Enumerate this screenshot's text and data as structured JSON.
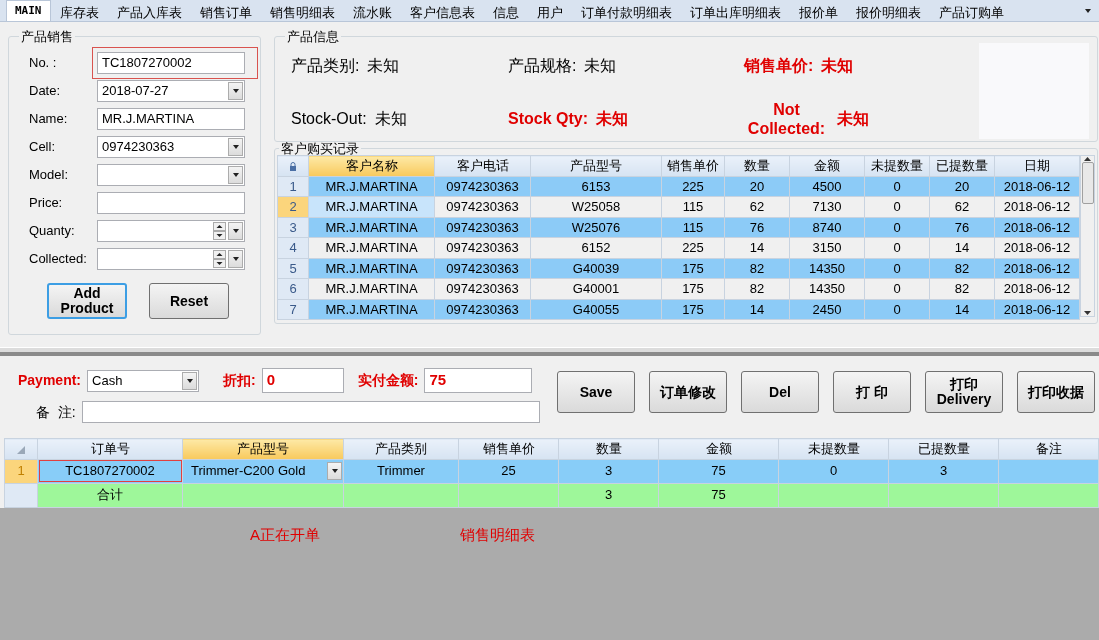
{
  "tabs": [
    {
      "label": "MAIN",
      "selected": true
    },
    {
      "label": "库存表",
      "selected": false
    },
    {
      "label": "产品入库表",
      "selected": false
    },
    {
      "label": "销售订单",
      "selected": false
    },
    {
      "label": "销售明细表",
      "selected": false
    },
    {
      "label": "流水账",
      "selected": false
    },
    {
      "label": "客户信息表",
      "selected": false
    },
    {
      "label": "信息",
      "selected": false
    },
    {
      "label": "用户",
      "selected": false
    },
    {
      "label": "订单付款明细表",
      "selected": false
    },
    {
      "label": "订单出库明细表",
      "selected": false
    },
    {
      "label": "报价单",
      "selected": false
    },
    {
      "label": "报价明细表",
      "selected": false
    },
    {
      "label": "产品订购单",
      "selected": false
    }
  ],
  "sales_form": {
    "title": "产品销售",
    "fields": [
      {
        "label": "No. :",
        "kind": "text",
        "value": "TC1807270002",
        "highlighted": true
      },
      {
        "label": "Date:",
        "kind": "combo",
        "value": "2018-07-27",
        "highlighted": false
      },
      {
        "label": "Name:",
        "kind": "text",
        "value": "MR.J.MARTINA",
        "highlighted": false
      },
      {
        "label": "Cell:",
        "kind": "combo",
        "value": "0974230363",
        "highlighted": false
      },
      {
        "label": "Model:",
        "kind": "combo",
        "highlighted": false
      },
      {
        "label": "Price:",
        "kind": "text",
        "highlighted": false
      },
      {
        "label": "Quanty:",
        "kind": "spin",
        "highlighted": false
      },
      {
        "label": "Collected:",
        "kind": "spin",
        "highlighted": false
      }
    ],
    "buttons": [
      {
        "label": "Add Product",
        "focused": true
      },
      {
        "label": "Reset",
        "focused": false
      }
    ]
  },
  "product_info": {
    "title": "产品信息",
    "items": [
      {
        "label": "产品类别:",
        "value": "未知",
        "emphasis": false
      },
      {
        "label": "产品规格:",
        "value": "未知",
        "emphasis": false
      },
      {
        "label": "销售单价:",
        "value": "未知",
        "emphasis": true
      },
      {
        "label": "Stock-Out:",
        "value": "未知",
        "emphasis": false
      },
      {
        "label": "Stock Qty:",
        "value": "未知",
        "emphasis": true
      },
      {
        "label": "Not Collected:",
        "value": "未知",
        "emphasis": true
      }
    ]
  },
  "purchase_history": {
    "title": "客户购买记录",
    "columns": [
      {
        "label": "客户名称",
        "selected": true
      },
      {
        "label": "客户电话",
        "selected": false
      },
      {
        "label": "产品型号",
        "selected": false
      },
      {
        "label": "销售单价",
        "selected": false
      },
      {
        "label": "数量",
        "selected": false
      },
      {
        "label": "金额",
        "selected": false
      },
      {
        "label": "未提数量",
        "selected": false
      },
      {
        "label": "已提数量",
        "selected": false
      },
      {
        "label": "日期",
        "selected": false
      }
    ],
    "rows": [
      {
        "number": "1",
        "current": false,
        "cells": [
          "MR.J.MARTINA",
          "0974230363",
          "6153",
          "225",
          "20",
          "4500",
          "0",
          "20",
          "2018-06-12"
        ]
      },
      {
        "number": "2",
        "current": true,
        "cells": [
          "MR.J.MARTINA",
          "0974230363",
          "W25058",
          "115",
          "62",
          "7130",
          "0",
          "62",
          "2018-06-12"
        ]
      },
      {
        "number": "3",
        "current": false,
        "cells": [
          "MR.J.MARTINA",
          "0974230363",
          "W25076",
          "115",
          "76",
          "8740",
          "0",
          "76",
          "2018-06-12"
        ]
      },
      {
        "number": "4",
        "current": false,
        "cells": [
          "MR.J.MARTINA",
          "0974230363",
          "6152",
          "225",
          "14",
          "3150",
          "0",
          "14",
          "2018-06-12"
        ]
      },
      {
        "number": "5",
        "current": false,
        "cells": [
          "MR.J.MARTINA",
          "0974230363",
          "G40039",
          "175",
          "82",
          "14350",
          "0",
          "82",
          "2018-06-12"
        ]
      },
      {
        "number": "6",
        "current": false,
        "cells": [
          "MR.J.MARTINA",
          "0974230363",
          "G40001",
          "175",
          "82",
          "14350",
          "0",
          "82",
          "2018-06-12"
        ]
      },
      {
        "number": "7",
        "current": false,
        "cells": [
          "MR.J.MARTINA",
          "0974230363",
          "G40055",
          "175",
          "14",
          "2450",
          "0",
          "14",
          "2018-06-12"
        ]
      }
    ]
  },
  "order": {
    "payment": {
      "label": "Payment:",
      "value": "Cash"
    },
    "discount": {
      "label": "折扣:",
      "value": "0"
    },
    "paid": {
      "label": "实付金额:",
      "value": "75"
    },
    "remark": {
      "label": "备  注:"
    },
    "buttons": [
      {
        "label": "Save"
      },
      {
        "label": "订单修改"
      },
      {
        "label": "Del"
      },
      {
        "label": "打 印"
      },
      {
        "label": "打印 Delivery"
      },
      {
        "label": "打印收据"
      }
    ]
  },
  "order_grid": {
    "columns": [
      {
        "label": "订单号",
        "selected": false
      },
      {
        "label": "产品型号",
        "selected": true
      },
      {
        "label": "产品类别",
        "selected": false
      },
      {
        "label": "销售单价",
        "selected": false
      },
      {
        "label": "数量",
        "selected": false
      },
      {
        "label": "金额",
        "selected": false
      },
      {
        "label": "未提数量",
        "selected": false
      },
      {
        "label": "已提数量",
        "selected": false
      },
      {
        "label": "备注",
        "selected": false
      }
    ],
    "rows": [
      {
        "number": "1",
        "cells": [
          {
            "text": "TC1807270002",
            "kind": "text",
            "highlighted": true
          },
          {
            "text": "Trimmer-C200 Gold",
            "kind": "dropdown",
            "highlighted": false
          },
          {
            "text": "Trimmer",
            "kind": "text",
            "highlighted": false
          },
          {
            "text": "25",
            "kind": "text",
            "highlighted": false
          },
          {
            "text": "3",
            "kind": "text",
            "highlighted": false
          },
          {
            "text": "75",
            "kind": "text",
            "highlighted": false
          },
          {
            "text": "0",
            "kind": "text",
            "highlighted": false
          },
          {
            "text": "3",
            "kind": "text",
            "highlighted": false
          },
          {
            "kind": "text",
            "highlighted": false
          }
        ]
      }
    ],
    "total": {
      "label": "合计",
      "cells": [
        "",
        "",
        "",
        "3",
        "75",
        "",
        "",
        ""
      ]
    }
  },
  "status_texts": [
    "A正在开单",
    "销售明细表"
  ]
}
